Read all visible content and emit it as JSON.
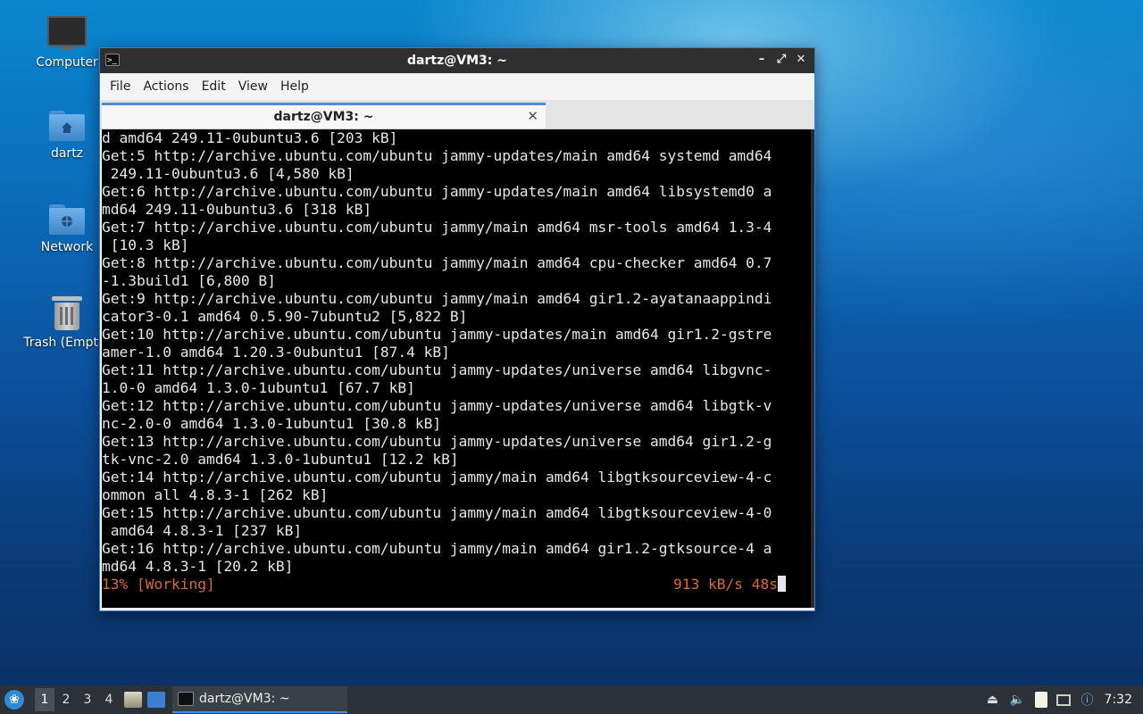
{
  "desktop": {
    "icons": [
      {
        "label": "Computer"
      },
      {
        "label": "dartz"
      },
      {
        "label": "Network"
      },
      {
        "label": "Trash (Empty)"
      }
    ]
  },
  "window": {
    "title": "dartz@VM3: ~",
    "menu": [
      "File",
      "Actions",
      "Edit",
      "View",
      "Help"
    ],
    "tab_label": "dartz@VM3: ~"
  },
  "terminal": {
    "lines": [
      "d amd64 249.11-0ubuntu3.6 [203 kB]",
      "Get:5 http://archive.ubuntu.com/ubuntu jammy-updates/main amd64 systemd amd64",
      " 249.11-0ubuntu3.6 [4,580 kB]",
      "Get:6 http://archive.ubuntu.com/ubuntu jammy-updates/main amd64 libsystemd0 a",
      "md64 249.11-0ubuntu3.6 [318 kB]",
      "Get:7 http://archive.ubuntu.com/ubuntu jammy/main amd64 msr-tools amd64 1.3-4",
      " [10.3 kB]",
      "Get:8 http://archive.ubuntu.com/ubuntu jammy/main amd64 cpu-checker amd64 0.7",
      "-1.3build1 [6,800 B]",
      "Get:9 http://archive.ubuntu.com/ubuntu jammy/main amd64 gir1.2-ayatanaappindi",
      "cator3-0.1 amd64 0.5.90-7ubuntu2 [5,822 B]",
      "Get:10 http://archive.ubuntu.com/ubuntu jammy-updates/main amd64 gir1.2-gstre",
      "amer-1.0 amd64 1.20.3-0ubuntu1 [87.4 kB]",
      "Get:11 http://archive.ubuntu.com/ubuntu jammy-updates/universe amd64 libgvnc-",
      "1.0-0 amd64 1.3.0-1ubuntu1 [67.7 kB]",
      "Get:12 http://archive.ubuntu.com/ubuntu jammy-updates/universe amd64 libgtk-v",
      "nc-2.0-0 amd64 1.3.0-1ubuntu1 [30.8 kB]",
      "Get:13 http://archive.ubuntu.com/ubuntu jammy-updates/universe amd64 gir1.2-g",
      "tk-vnc-2.0 amd64 1.3.0-1ubuntu1 [12.2 kB]",
      "Get:14 http://archive.ubuntu.com/ubuntu jammy/main amd64 libgtksourceview-4-c",
      "ommon all 4.8.3-1 [262 kB]",
      "Get:15 http://archive.ubuntu.com/ubuntu jammy/main amd64 libgtksourceview-4-0",
      " amd64 4.8.3-1 [237 kB]",
      "Get:16 http://archive.ubuntu.com/ubuntu jammy/main amd64 gir1.2-gtksource-4 a",
      "md64 4.8.3-1 [20.2 kB]"
    ],
    "status_left": "13% [Working]",
    "status_right": "913 kB/s 48s",
    "status_color": "#d96b2b"
  },
  "taskbar": {
    "workspaces": [
      "1",
      "2",
      "3",
      "4"
    ],
    "active_workspace": "1",
    "task_label": "dartz@VM3: ~",
    "clock": "7:32"
  }
}
